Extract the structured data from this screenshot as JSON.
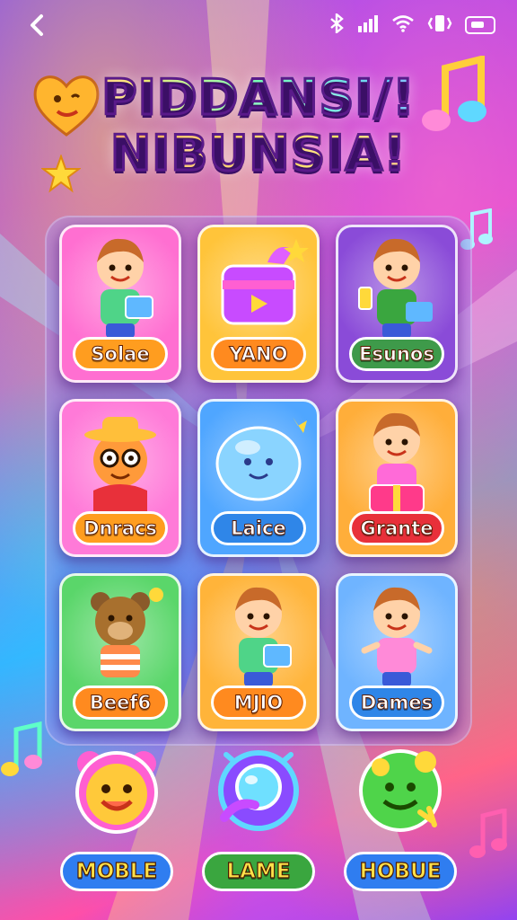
{
  "status": {
    "back_icon": "chevron-left-icon",
    "icons": [
      "bluetooth-icon",
      "signal-icon",
      "wifi-icon",
      "vibrate-icon",
      "battery-icon"
    ]
  },
  "title": {
    "line1": "PIDDANSI/!",
    "line2": "NIBUNSIA!"
  },
  "cards": [
    {
      "label": "Solae",
      "theme": "kid-with-tablet",
      "bg": "#ff6fd1",
      "pill": "#ff9d1f"
    },
    {
      "label": "YANO",
      "theme": "purple-gift-box",
      "bg": "#ffc43a",
      "pill": "#ff8a1f"
    },
    {
      "label": "Esunos",
      "theme": "kid-with-phone",
      "bg": "#8a4bd8",
      "pill": "#3e9a4a"
    },
    {
      "label": "Dnracs",
      "theme": "hat-character",
      "bg": "#ff7ad8",
      "pill": "#ff9d1f"
    },
    {
      "label": "Laice",
      "theme": "blue-blob",
      "bg": "#4fa6ff",
      "pill": "#2f86e8"
    },
    {
      "label": "Grante",
      "theme": "kid-with-gift",
      "bg": "#ffae3a",
      "pill": "#e8303a"
    },
    {
      "label": "Beef6",
      "theme": "bear",
      "bg": "#5ad66a",
      "pill": "#ff8a1f"
    },
    {
      "label": "MJIO",
      "theme": "kid-with-tablet",
      "bg": "#ffb43a",
      "pill": "#ff8a1f"
    },
    {
      "label": "Dames",
      "theme": "girl-dancing",
      "bg": "#6fb4ff",
      "pill": "#2f86e8"
    }
  ],
  "bottom": [
    {
      "label": "MOBLE",
      "icon": "smiley-bear-icon",
      "pill": "#2f7df0"
    },
    {
      "label": "LAME",
      "icon": "ring-icon",
      "pill": "#3aa63f"
    },
    {
      "label": "HOBUE",
      "icon": "green-smiley-icon",
      "pill": "#2f7df0"
    }
  ],
  "colors": {
    "panel": "#7a5ae6",
    "accent": "#ffe14a"
  }
}
